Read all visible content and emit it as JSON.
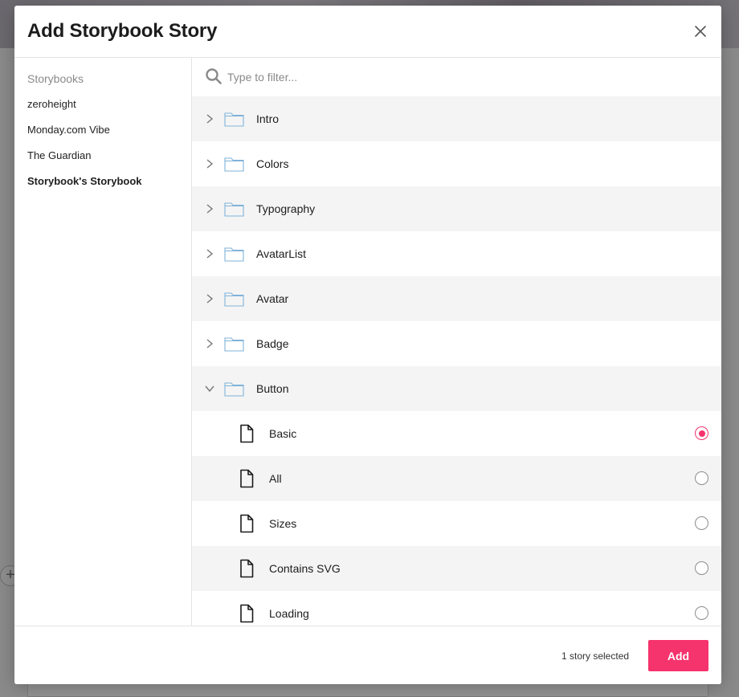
{
  "modal": {
    "title": "Add Storybook Story",
    "close_icon": "close-icon"
  },
  "sidebar": {
    "heading": "Storybooks",
    "items": [
      {
        "label": "zeroheight",
        "active": false
      },
      {
        "label": "Monday.com Vibe",
        "active": false
      },
      {
        "label": "The Guardian",
        "active": false
      },
      {
        "label": "Storybook's Storybook",
        "active": true
      }
    ]
  },
  "filter": {
    "placeholder": "Type to filter...",
    "value": "",
    "icon": "search-icon"
  },
  "tree": {
    "folders": [
      {
        "label": "Intro",
        "expanded": false
      },
      {
        "label": "Colors",
        "expanded": false
      },
      {
        "label": "Typography",
        "expanded": false
      },
      {
        "label": "AvatarList",
        "expanded": false
      },
      {
        "label": "Avatar",
        "expanded": false
      },
      {
        "label": "Badge",
        "expanded": false
      },
      {
        "label": "Button",
        "expanded": true
      }
    ],
    "stories": [
      {
        "label": "Basic",
        "selected": true
      },
      {
        "label": "All",
        "selected": false
      },
      {
        "label": "Sizes",
        "selected": false
      },
      {
        "label": "Contains SVG",
        "selected": false
      },
      {
        "label": "Loading",
        "selected": false
      }
    ]
  },
  "footer": {
    "selected_count": "1 story selected",
    "add_label": "Add"
  },
  "colors": {
    "accent": "#f5336d",
    "folder_stroke": "#7fb3d9",
    "row_shade": "#f4f4f4"
  }
}
